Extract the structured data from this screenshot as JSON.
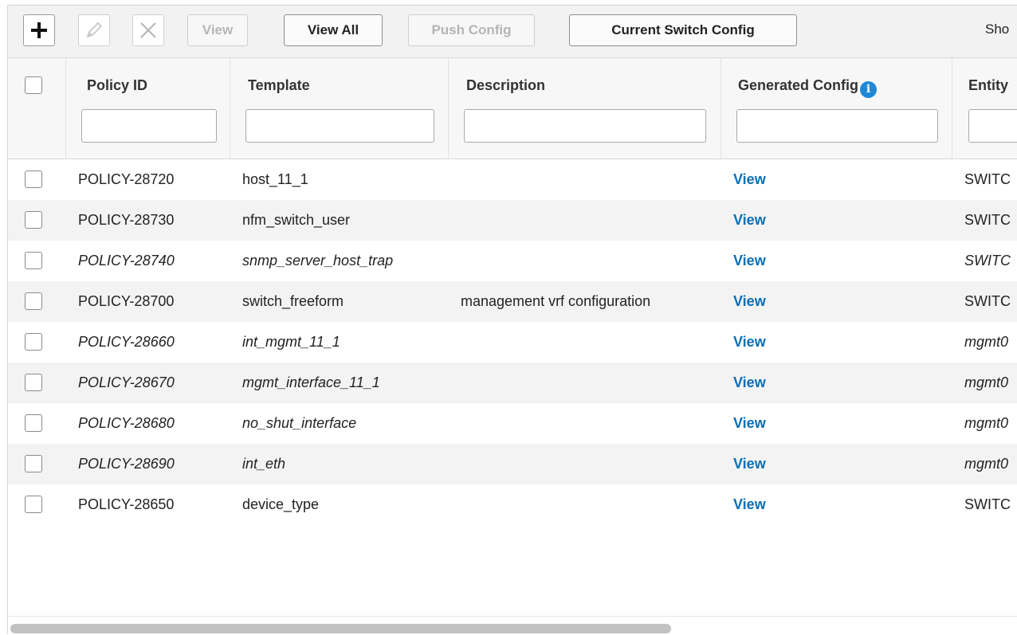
{
  "toolbar": {
    "add_icon": "plus-icon",
    "edit_icon": "pencil-icon",
    "delete_icon": "x-icon",
    "view_label": "View",
    "view_all_label": "View All",
    "push_config_label": "Push Config",
    "current_switch_config_label": "Current Switch Config",
    "show_label": "Sho"
  },
  "table": {
    "columns": {
      "policy_id": "Policy ID",
      "template": "Template",
      "description": "Description",
      "generated_config": "Generated Config",
      "entity": "Entity"
    },
    "info_icon": "info-icon",
    "link_color": "#0a6eb4",
    "rows": [
      {
        "policy_id": "POLICY-28720",
        "template": "host_11_1",
        "description": "",
        "generated_config": "View",
        "entity": "SWITC",
        "italic": false
      },
      {
        "policy_id": "POLICY-28730",
        "template": "nfm_switch_user",
        "description": "",
        "generated_config": "View",
        "entity": "SWITC",
        "italic": false
      },
      {
        "policy_id": "POLICY-28740",
        "template": "snmp_server_host_trap",
        "description": "",
        "generated_config": "View",
        "entity": "SWITC",
        "italic": true
      },
      {
        "policy_id": "POLICY-28700",
        "template": "switch_freeform",
        "description": "management vrf configuration",
        "generated_config": "View",
        "entity": "SWITC",
        "italic": false
      },
      {
        "policy_id": "POLICY-28660",
        "template": "int_mgmt_11_1",
        "description": "",
        "generated_config": "View",
        "entity": "mgmt0",
        "italic": true
      },
      {
        "policy_id": "POLICY-28670",
        "template": "mgmt_interface_11_1",
        "description": "",
        "generated_config": "View",
        "entity": "mgmt0",
        "italic": true
      },
      {
        "policy_id": "POLICY-28680",
        "template": "no_shut_interface",
        "description": "",
        "generated_config": "View",
        "entity": "mgmt0",
        "italic": true
      },
      {
        "policy_id": "POLICY-28690",
        "template": "int_eth",
        "description": "",
        "generated_config": "View",
        "entity": "mgmt0",
        "italic": true
      },
      {
        "policy_id": "POLICY-28650",
        "template": "device_type",
        "description": "",
        "generated_config": "View",
        "entity": "SWITC",
        "italic": false
      }
    ]
  }
}
